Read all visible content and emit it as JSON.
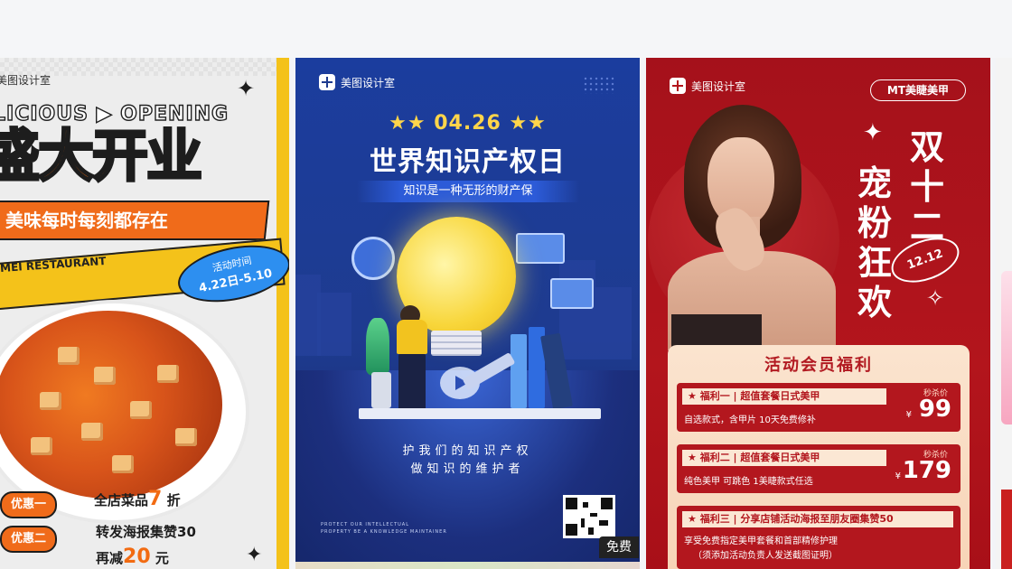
{
  "cards": [
    {
      "brand": "美图设计室",
      "opening": "LICIOUS ▶ OPENING",
      "title": "盛大开业",
      "ribbon": "美味每时每刻都存在",
      "restaurant": "MEI RESTAURANT",
      "date_label": "活动时间",
      "date_range": "4.22日-5.10",
      "promo1_label": "优惠一",
      "promo1_text": "全店菜品",
      "promo1_num": "7",
      "promo1_unit": "折",
      "promo2_label": "优惠二",
      "promo2_text": "转发海报集赞30",
      "promo3_prefix": "再减",
      "promo3_num": "20",
      "promo3_unit": "元",
      "colors": {
        "orange": "#f26b12",
        "yellow": "#f4c21a",
        "blue": "#2d8ff0"
      }
    },
    {
      "brand": "美图设计室",
      "date": "04.26",
      "title": "世界知识产权日",
      "subtitle": "知识是一种无形的财产保",
      "motto1": "护我们的知识产权",
      "motto2": "做知识的维护者",
      "tiny1": "PROTECT OUR INTELLECTUAL",
      "tiny2": "PROPERTY BE A KNOWLEDGE MAINTAINER",
      "free_badge": "免费",
      "colors": {
        "bg": "#1e3b8f",
        "bulb": "#f8d63a"
      }
    },
    {
      "brand": "美图设计室",
      "tag": "MT美睫美甲",
      "headline": [
        "双",
        "十",
        "二",
        "宠",
        "粉",
        "狂",
        "欢"
      ],
      "date_oval": "12.12",
      "panel_title": "活动会员福利",
      "offers": [
        {
          "head": "★ 福利一 | 超值套餐日式美甲",
          "desc": "自选款式，含甲片 10天免费修补",
          "price_label": "秒杀价",
          "yen": "¥",
          "price": "99"
        },
        {
          "head": "★ 福利二 | 超值套餐日式美甲",
          "desc": "纯色美甲 可跳色   1美睫款式任选",
          "price_label": "秒杀价",
          "yen": "¥",
          "price": "179"
        },
        {
          "head": "★ 福利三 | 分享店铺活动海报至朋友圈集赞50",
          "desc": "享受免费指定美甲套餐和首部精修护理",
          "note": "（须添加活动负责人发送截图证明）"
        }
      ],
      "colors": {
        "red": "#b3151c",
        "cream": "#fbe4cf"
      }
    }
  ]
}
